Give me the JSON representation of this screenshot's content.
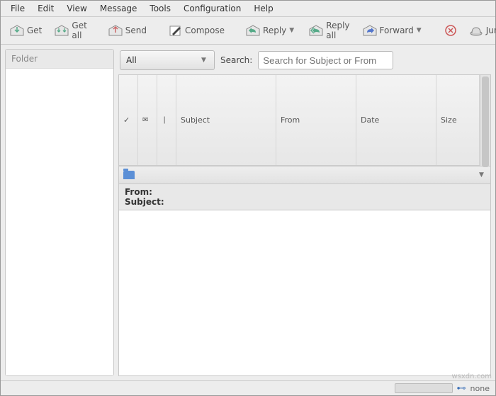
{
  "menubar": [
    "File",
    "Edit",
    "View",
    "Message",
    "Tools",
    "Configuration",
    "Help"
  ],
  "toolbar": {
    "get": "Get",
    "getall": "Get all",
    "send": "Send",
    "compose": "Compose",
    "reply": "Reply",
    "replyall": "Reply all",
    "forward": "Forward",
    "junk": "Junk"
  },
  "sidebar": {
    "title": "Folder"
  },
  "search": {
    "filter_value": "All",
    "label": "Search:",
    "placeholder": "Search for Subject or From"
  },
  "columns": {
    "mark": "✓",
    "status": "",
    "attach": "",
    "subject": "Subject",
    "from": "From",
    "date": "Date",
    "size": "Size"
  },
  "preview": {
    "from_label": "From:",
    "subject_label": "Subject:"
  },
  "status": {
    "net": "none"
  },
  "watermark": "wsxdn.com"
}
